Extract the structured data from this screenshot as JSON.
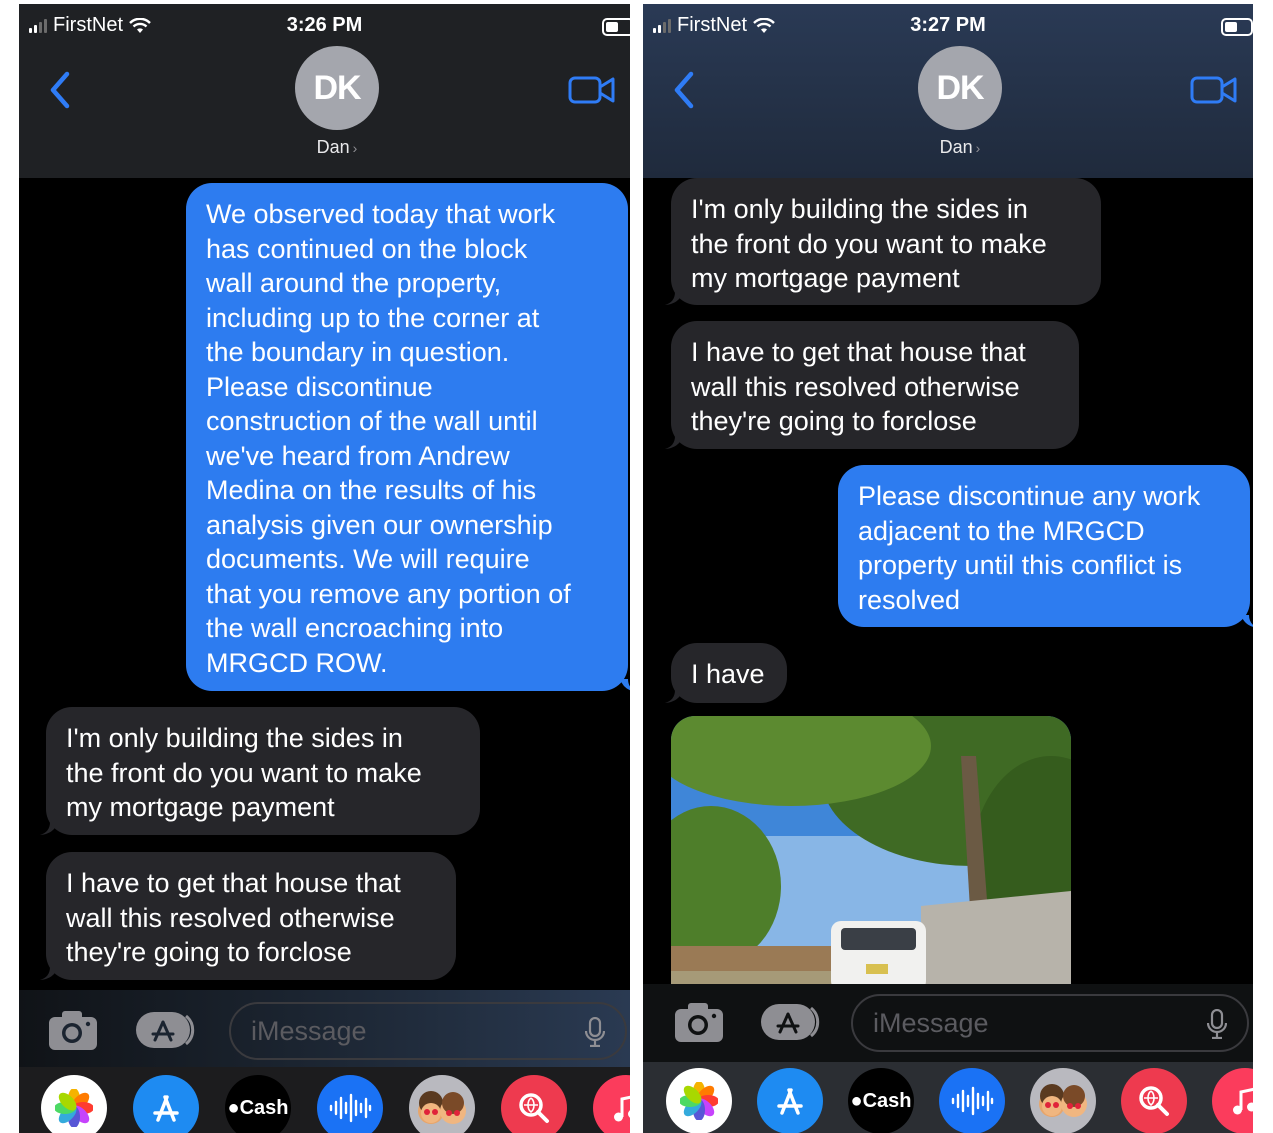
{
  "left": {
    "carrier": "FirstNet",
    "time": "3:26 PM",
    "contact_initials": "DK",
    "contact_name": "Dan",
    "messages": [
      {
        "type": "sent",
        "text": "We observed today that work\nhas continued on the block\nwall around the property,\nincluding up to the corner at\nthe boundary in question.\nPlease discontinue\nconstruction of the wall until\nwe've heard from Andrew\nMedina on the results of his\nanalysis given our ownership\ndocuments. We will require\nthat you remove any portion of\nthe wall encroaching into\nMRGCD ROW."
      },
      {
        "type": "received",
        "text": "I'm only building the sides in\nthe front do you want to make\nmy mortgage payment"
      },
      {
        "type": "received",
        "text": "I have to get that house that\nwall this resolved otherwise\nthey're going to forclose"
      }
    ],
    "input_placeholder": "iMessage",
    "cash_label": "Cash"
  },
  "right": {
    "carrier": "FirstNet",
    "time": "3:27 PM",
    "contact_initials": "DK",
    "contact_name": "Dan",
    "messages": [
      {
        "type": "received",
        "text": "I'm only building the sides in\nthe front do you want to make\nmy mortgage payment"
      },
      {
        "type": "received",
        "text": "I have to get that house that\nwall this resolved otherwise\nthey're going to forclose"
      },
      {
        "type": "sent",
        "text": "Please discontinue any work\nadjacent to the MRGCD\nproperty until this conflict is\nresolved"
      },
      {
        "type": "received",
        "text": "I have"
      },
      {
        "type": "received-image",
        "icon": "photo-attachment"
      }
    ],
    "input_placeholder": "iMessage",
    "cash_label": "Cash"
  },
  "colors": {
    "sent_bubble": "#2d7cf0",
    "received_bubble": "#26262a",
    "accent": "#2f7cf6"
  }
}
